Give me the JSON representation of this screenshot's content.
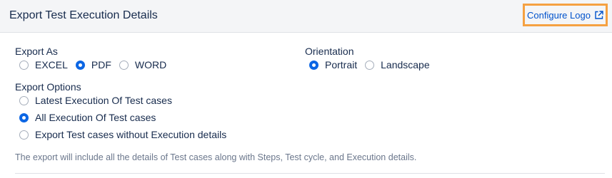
{
  "header": {
    "title": "Export Test Execution Details",
    "configure_logo_label": "Configure Logo"
  },
  "export_as": {
    "label": "Export As",
    "options": [
      {
        "label": "EXCEL",
        "selected": false
      },
      {
        "label": "PDF",
        "selected": true
      },
      {
        "label": "WORD",
        "selected": false
      }
    ]
  },
  "orientation": {
    "label": "Orientation",
    "options": [
      {
        "label": "Portrait",
        "selected": true
      },
      {
        "label": "Landscape",
        "selected": false
      }
    ]
  },
  "export_options": {
    "label": "Export Options",
    "options": [
      {
        "label": "Latest Execution Of Test cases",
        "selected": false
      },
      {
        "label": "All Execution Of Test cases",
        "selected": true
      },
      {
        "label": "Export Test cases without Execution details",
        "selected": false
      }
    ]
  },
  "note": "The export will include all the details of Test cases along with Steps, Test cycle, and Execution details.",
  "colors": {
    "accent": "#0c66e4",
    "highlight_border": "#f5a142",
    "link": "#0052cc"
  },
  "icons": {
    "configure_logo": "external-link-icon"
  }
}
